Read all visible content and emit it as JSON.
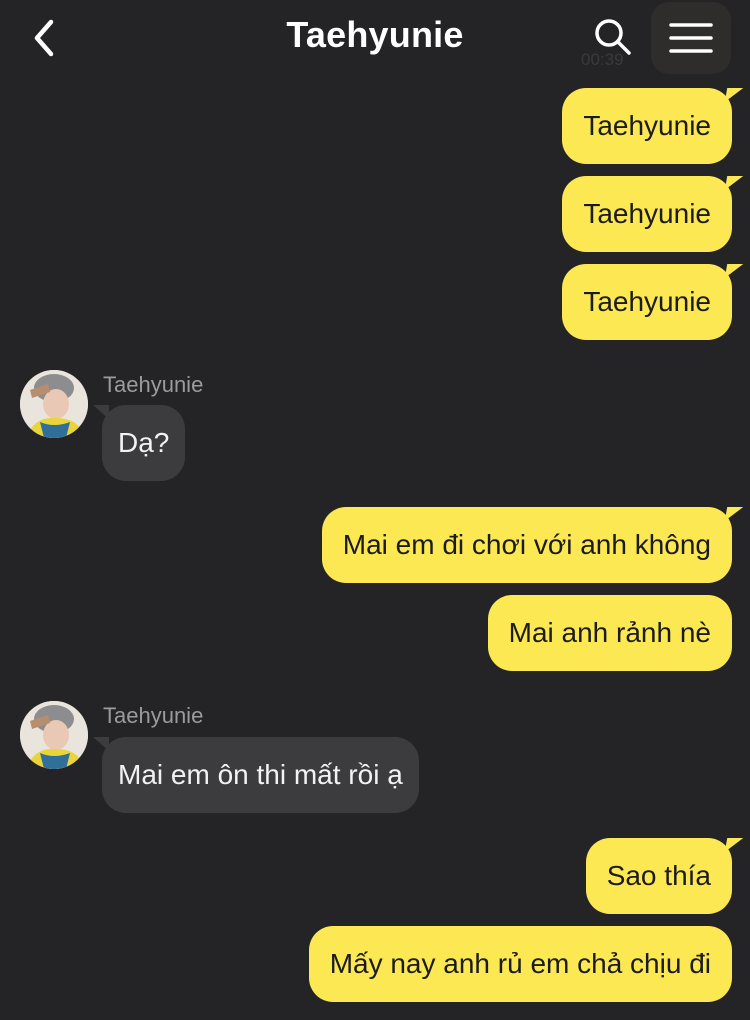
{
  "header": {
    "title": "Taehyunie",
    "faded_time": "00:39"
  },
  "colors": {
    "background": "#242426",
    "outgoing_bubble": "#fce853",
    "incoming_bubble": "#3c3c3e",
    "sender_name": "#9b9b9b"
  },
  "icons": {
    "back": "chevron-left-icon",
    "search": "search-icon",
    "menu": "hamburger-menu-icon",
    "avatar": "profile-photo"
  },
  "messages": [
    {
      "direction": "out",
      "text": "Taehyunie"
    },
    {
      "direction": "out",
      "text": "Taehyunie"
    },
    {
      "direction": "out",
      "text": "Taehyunie"
    },
    {
      "direction": "in",
      "sender": "Taehyunie",
      "text": "Dạ?"
    },
    {
      "direction": "out",
      "text": "Mai em đi chơi với anh không"
    },
    {
      "direction": "out",
      "text": "Mai anh rảnh nè"
    },
    {
      "direction": "in",
      "sender": "Taehyunie",
      "text": "Mai em ôn thi mất rồi ạ"
    },
    {
      "direction": "out",
      "text": "Sao thía"
    },
    {
      "direction": "out",
      "text": "Mấy nay anh rủ em chả chịu đi"
    }
  ]
}
